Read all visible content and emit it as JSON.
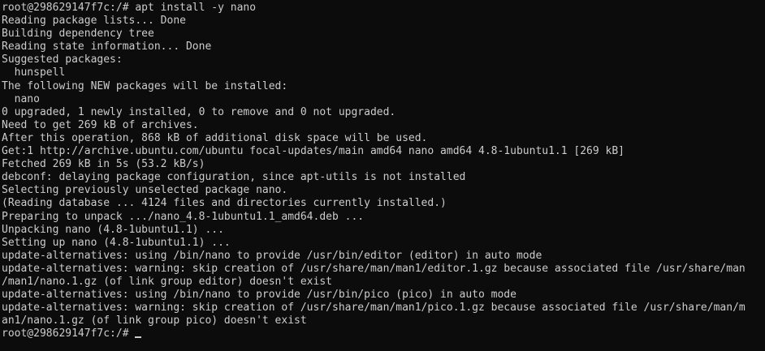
{
  "colors": {
    "background": "#0c0c0c",
    "foreground": "#cccccc"
  },
  "terminal": {
    "prompt": "root@298629147f7c:/# ",
    "lines": [
      "root@298629147f7c:/# apt install -y nano",
      "Reading package lists... Done",
      "Building dependency tree",
      "Reading state information... Done",
      "Suggested packages:",
      "  hunspell",
      "The following NEW packages will be installed:",
      "  nano",
      "0 upgraded, 1 newly installed, 0 to remove and 0 not upgraded.",
      "Need to get 269 kB of archives.",
      "After this operation, 868 kB of additional disk space will be used.",
      "Get:1 http://archive.ubuntu.com/ubuntu focal-updates/main amd64 nano amd64 4.8-1ubuntu1.1 [269 kB]",
      "Fetched 269 kB in 5s (53.2 kB/s)",
      "debconf: delaying package configuration, since apt-utils is not installed",
      "Selecting previously unselected package nano.",
      "(Reading database ... 4124 files and directories currently installed.)",
      "Preparing to unpack .../nano_4.8-1ubuntu1.1_amd64.deb ...",
      "Unpacking nano (4.8-1ubuntu1.1) ...",
      "Setting up nano (4.8-1ubuntu1.1) ...",
      "update-alternatives: using /bin/nano to provide /usr/bin/editor (editor) in auto mode",
      "update-alternatives: warning: skip creation of /usr/share/man/man1/editor.1.gz because associated file /usr/share/man",
      "/man1/nano.1.gz (of link group editor) doesn't exist",
      "update-alternatives: using /bin/nano to provide /usr/bin/pico (pico) in auto mode",
      "update-alternatives: warning: skip creation of /usr/share/man/man1/pico.1.gz because associated file /usr/share/man/m",
      "an1/nano.1.gz (of link group pico) doesn't exist"
    ]
  }
}
